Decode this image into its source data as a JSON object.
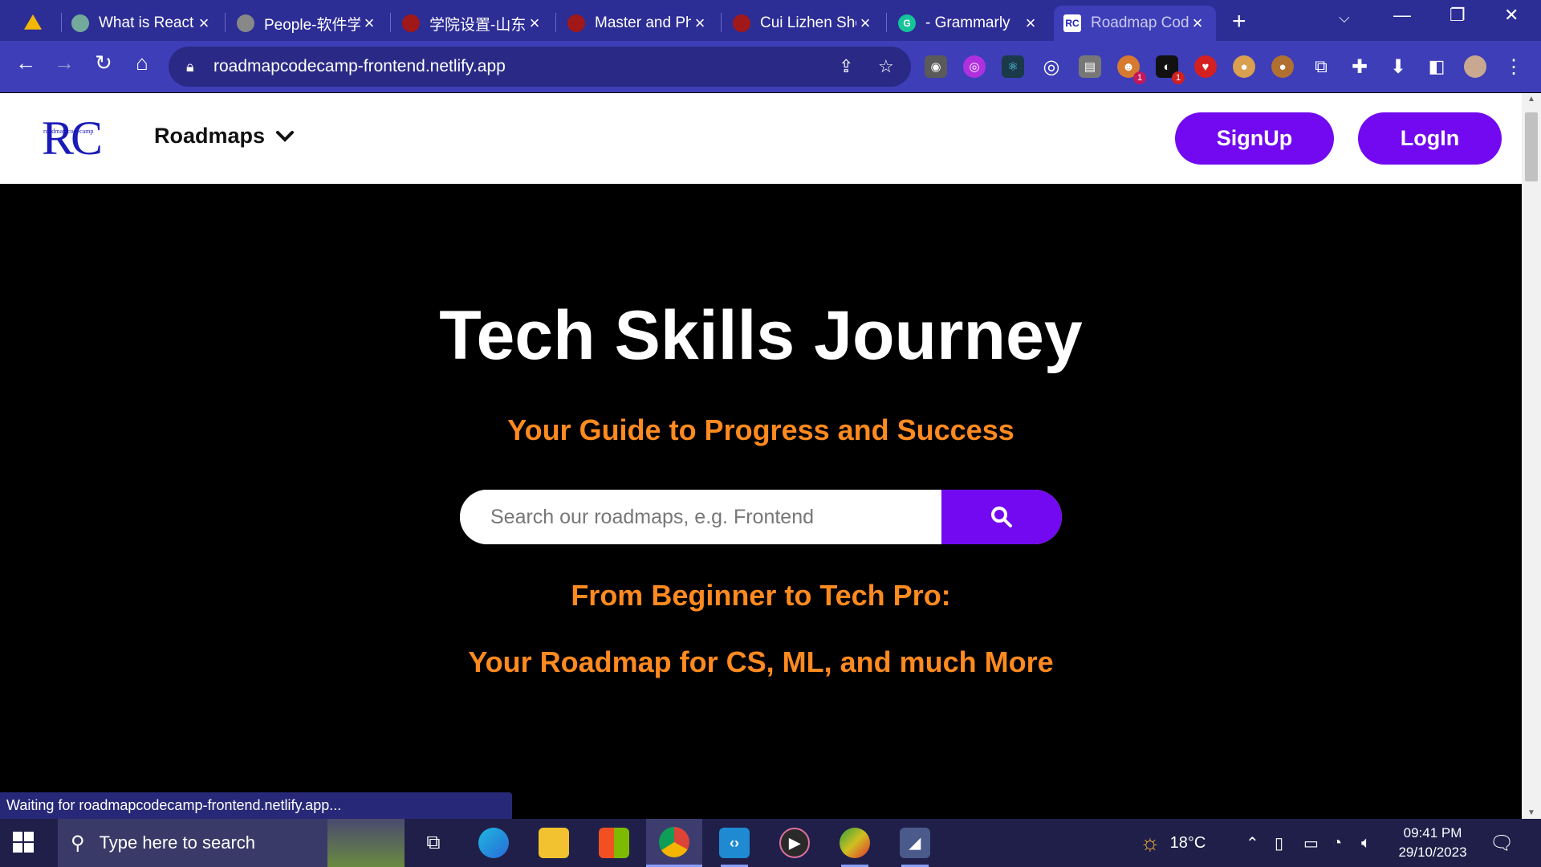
{
  "browser": {
    "tabs": [
      {
        "title": "",
        "favicon_color": "#f2b807"
      },
      {
        "title": "What is React",
        "favicon_color": "#74aa9c"
      },
      {
        "title": "People-软件学",
        "favicon_color": "#888888"
      },
      {
        "title": "学院设置-山东",
        "favicon_color": "#a01818"
      },
      {
        "title": "Master and PhD",
        "favicon_color": "#a01818"
      },
      {
        "title": "Cui Lizhen Sho",
        "favicon_color": "#a01818"
      },
      {
        "title": "- Grammarly",
        "favicon_color": "#15c39a"
      },
      {
        "title": "Roadmap Code",
        "favicon_color": "#ffffff"
      }
    ],
    "url": "roadmapcodecamp-frontend.netlify.app",
    "status": "Waiting for roadmapcodecamp-frontend.netlify.app...",
    "colors": {
      "frame": "#2d2d96",
      "toolbar": "#3e3eb8"
    }
  },
  "site": {
    "logo": {
      "big": "RC",
      "small": "roadmap codecamp"
    },
    "nav_roadmaps": "Roadmaps",
    "signup": "SignUp",
    "login": "LogIn",
    "hero": {
      "title": "Tech Skills Journey",
      "subtitle": "Your Guide to Progress and Success",
      "search_placeholder": "Search our roadmaps, e.g. Frontend",
      "tag1": "From Beginner to Tech Pro:",
      "tag2": "Your Roadmap for CS, ML, and much More"
    },
    "colors": {
      "accent": "#7209f0",
      "highlight": "#ff8a1f"
    }
  },
  "taskbar": {
    "search_placeholder": "Type here to search",
    "weather": "18°C",
    "time": "09:41 PM",
    "date": "29/10/2023",
    "badges": [
      "1",
      "1"
    ]
  }
}
